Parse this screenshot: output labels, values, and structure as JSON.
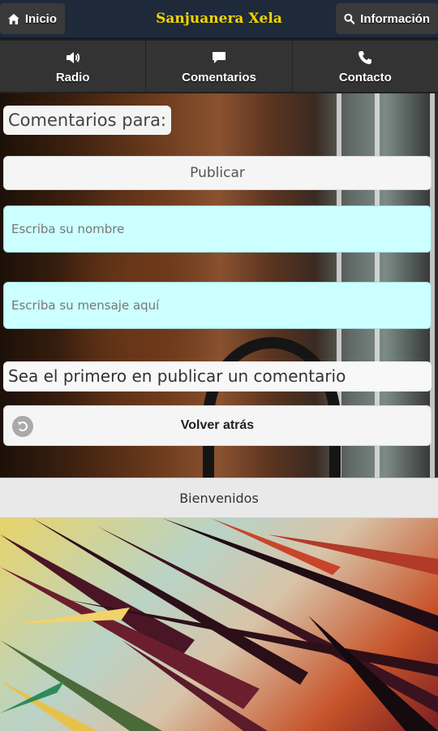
{
  "header": {
    "home_label": "Inicio",
    "title": "Sanjuanera Xela",
    "info_label": "Información",
    "title_color": "#f2d400"
  },
  "nav": {
    "items": [
      {
        "label": "Radio",
        "icon": "speaker-icon"
      },
      {
        "label": "Comentarios",
        "icon": "comment-icon"
      },
      {
        "label": "Contacto",
        "icon": "phone-icon"
      }
    ]
  },
  "comments": {
    "heading": "Comentarios para:",
    "publish_label": "Publicar",
    "name_placeholder": "Escriba su nombre",
    "message_placeholder": "Escriba su mensaje aquí",
    "empty_text": "Sea el primero en publicar un comentario",
    "back_label": "Volver atrás",
    "field_color": "#ccffff"
  },
  "footer": {
    "text": "Bienvenidos"
  }
}
